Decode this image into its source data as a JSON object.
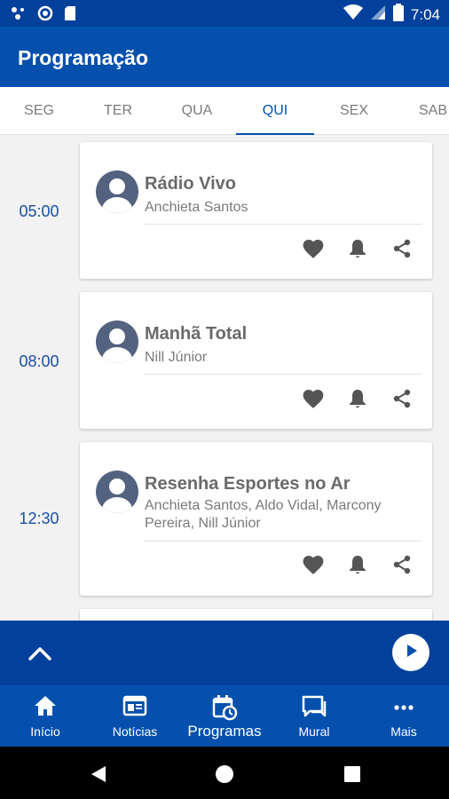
{
  "status_bar": {
    "time": "7:04"
  },
  "app_bar": {
    "title": "Programação"
  },
  "tabs": [
    {
      "label": "SEG",
      "active": false
    },
    {
      "label": "TER",
      "active": false
    },
    {
      "label": "QUA",
      "active": false
    },
    {
      "label": "QUI",
      "active": true
    },
    {
      "label": "SEX",
      "active": false
    },
    {
      "label": "SAB",
      "active": false
    }
  ],
  "schedule": [
    {
      "time": "05:00",
      "title": "Rádio Vivo",
      "hosts": "Anchieta Santos"
    },
    {
      "time": "08:00",
      "title": "Manhã Total",
      "hosts": "Nill Júnior"
    },
    {
      "time": "12:30",
      "title": "Resenha Esportes no Ar",
      "hosts": "Anchieta Santos, Aldo Vidal, Marcony Pereira, Nill Júnior"
    }
  ],
  "card_actions": [
    "heart-icon",
    "bell-icon",
    "share-icon"
  ],
  "player": {
    "toggle_icon": "chevron-up-icon",
    "play_icon": "play-icon"
  },
  "bottom_nav": [
    {
      "label": "Início",
      "icon": "home-icon",
      "active": false
    },
    {
      "label": "Notícias",
      "icon": "news-icon",
      "active": false
    },
    {
      "label": "Programas",
      "icon": "calendar-clock-icon",
      "active": true
    },
    {
      "label": "Mural",
      "icon": "chat-icon",
      "active": false
    },
    {
      "label": "Mais",
      "icon": "more-icon",
      "active": false
    }
  ],
  "colors": {
    "primary": "#0550ad",
    "primary_dark": "#01409b",
    "time_text": "#1a4fa0",
    "icon_gray": "#555555"
  }
}
